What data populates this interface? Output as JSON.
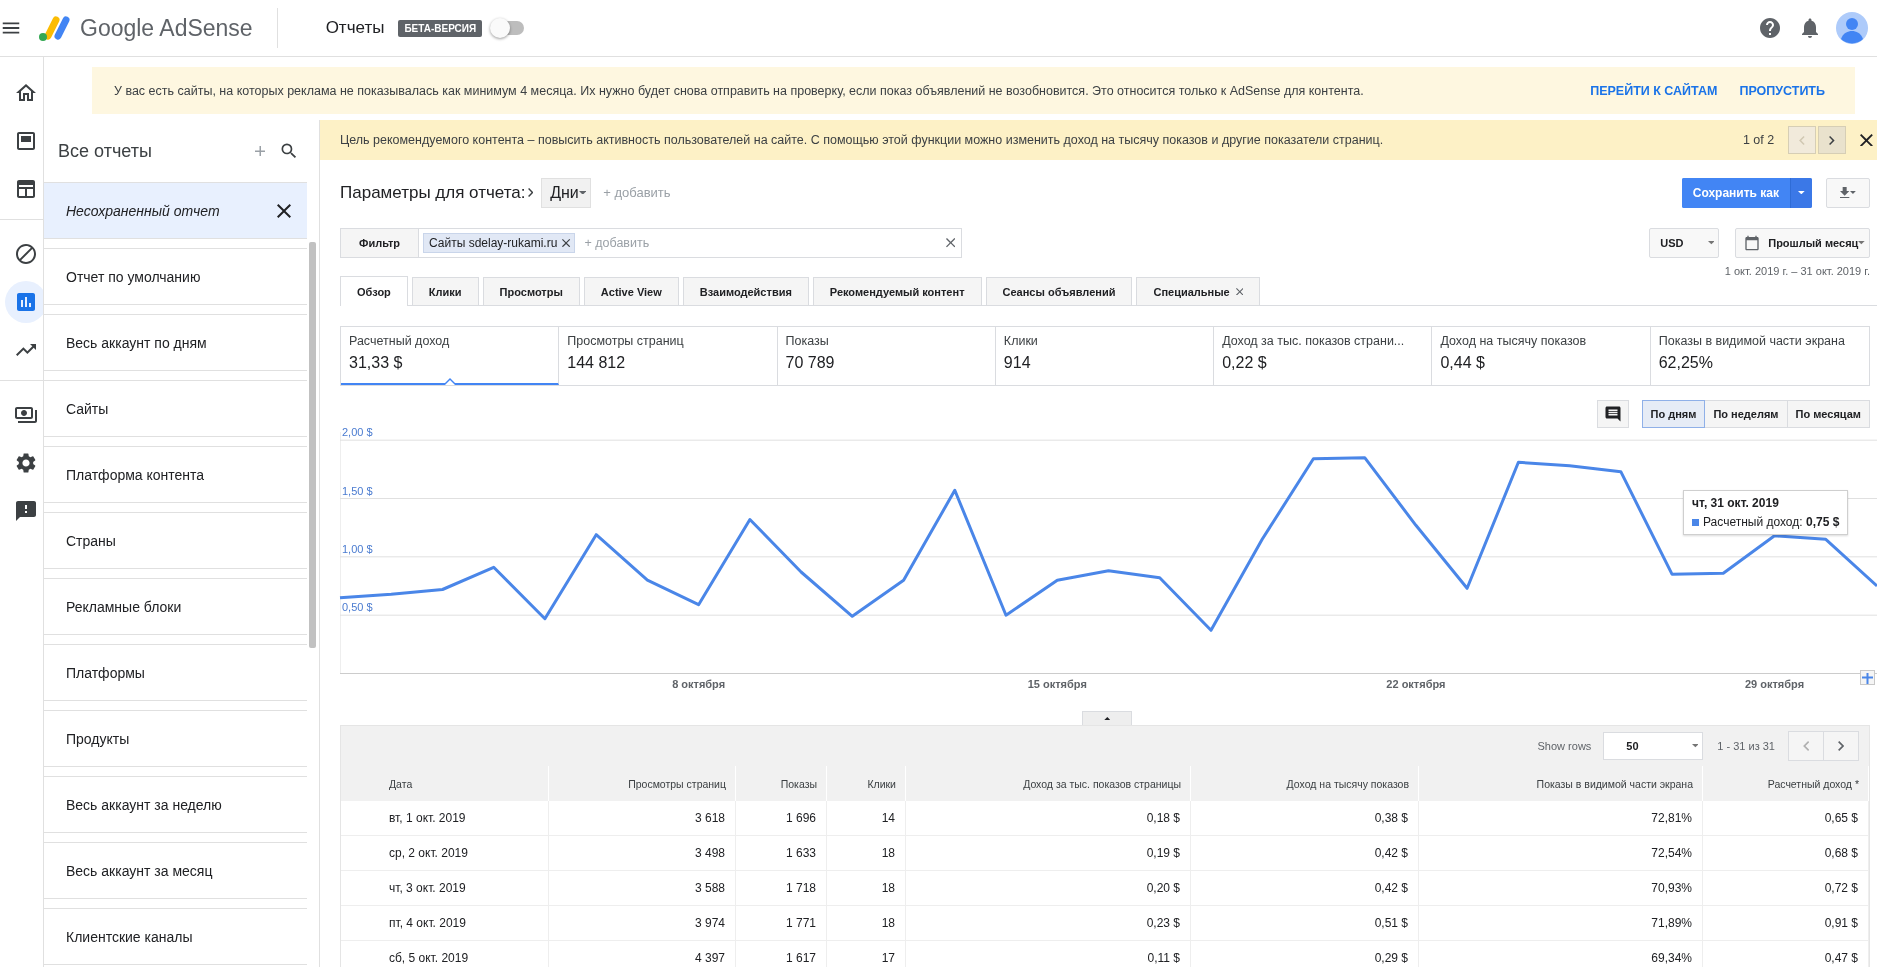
{
  "app_bar": {
    "product": "Google AdSense",
    "section": "Отчеты",
    "badge": "БЕТА-ВЕРСИЯ",
    "beta_toggle": {
      "on": false
    }
  },
  "rail_groups": [
    {
      "items": [
        {
          "kind": "home",
          "selected": false
        },
        {
          "kind": "display",
          "selected": false
        },
        {
          "kind": "layout",
          "selected": false
        }
      ]
    },
    {
      "items": [
        {
          "kind": "block",
          "selected": false
        },
        {
          "kind": "reports",
          "selected": true
        },
        {
          "kind": "trending",
          "selected": false
        }
      ]
    },
    {
      "items": [
        {
          "kind": "payments",
          "selected": false
        },
        {
          "kind": "settings",
          "selected": false
        },
        {
          "kind": "feedback",
          "selected": false
        }
      ]
    }
  ],
  "notice": {
    "text": "У вас есть сайты, на которых реклама не показывалась как минимум 4 месяца. Их нужно будет снова отправить на проверку, если показ объявлений не возобновится. Это относится только к AdSense для контента.",
    "actions": [
      "ПЕРЕЙТИ К САЙТАМ",
      "ПРОПУСТИТЬ"
    ]
  },
  "reports_panel": {
    "title": "Все отчеты",
    "items": [
      {
        "kind": "unsaved",
        "label": "Несохраненный отчет",
        "selected": true
      },
      {
        "kind": "saved",
        "label": "Отчет по умолчанию",
        "selected": false
      },
      {
        "kind": "saved",
        "label": "Весь аккаунт по дням",
        "selected": false
      },
      {
        "kind": "saved",
        "label": "Сайты",
        "selected": false
      },
      {
        "kind": "saved",
        "label": "Платформа контента",
        "selected": false
      },
      {
        "kind": "saved",
        "label": "Страны",
        "selected": false
      },
      {
        "kind": "saved",
        "label": "Рекламные блоки",
        "selected": false
      },
      {
        "kind": "saved",
        "label": "Платформы",
        "selected": false
      },
      {
        "kind": "saved",
        "label": "Продукты",
        "selected": false
      },
      {
        "kind": "saved",
        "label": "Весь аккаунт за неделю",
        "selected": false
      },
      {
        "kind": "saved",
        "label": "Весь аккаунт за месяц",
        "selected": false
      },
      {
        "kind": "saved",
        "label": "Клиентские каналы",
        "selected": false
      }
    ]
  },
  "tip_bar": {
    "text": "Цель рекомендуемого контента – повысить активность пользователей на сайте. С помощью этой функции можно изменить доход на тысячу показов и другие показатели страниц.",
    "pager": "1 of 2",
    "prev_disabled": true
  },
  "report": {
    "params_label": "Параметры для отчета:",
    "dimension": "Дни",
    "add_dimension": "+ добавить",
    "save_button": "Сохранить как",
    "filter_button": "Фильтр",
    "filter_chips": [
      "Сайты sdelay-rukami.ru"
    ],
    "filter_placeholder": "+ добавить",
    "currency": "USD",
    "date_preset": "Прошлый месяц",
    "date_range": "1 окт. 2019 г. – 31 окт. 2019 г.",
    "tabs": [
      {
        "label": "Обзор",
        "selected": true,
        "closable": false
      },
      {
        "label": "Клики",
        "selected": false,
        "closable": false
      },
      {
        "label": "Просмотры",
        "selected": false,
        "closable": false
      },
      {
        "label": "Active View",
        "selected": false,
        "closable": false
      },
      {
        "label": "Взаимодействия",
        "selected": false,
        "closable": false
      },
      {
        "label": "Рекомендуемый контент",
        "selected": false,
        "closable": false
      },
      {
        "label": "Сеансы объявлений",
        "selected": false,
        "closable": false
      },
      {
        "label": "Специальные",
        "selected": false,
        "closable": true
      }
    ]
  },
  "metrics": [
    {
      "label": "Расчетный доход",
      "value": "31,33 $",
      "selected": true
    },
    {
      "label": "Просмотры страниц",
      "value": "144 812",
      "selected": false
    },
    {
      "label": "Показы",
      "value": "70 789",
      "selected": false
    },
    {
      "label": "Клики",
      "value": "914",
      "selected": false
    },
    {
      "label": "Доход за тыс. показов страни...",
      "value": "0,22 $",
      "selected": false
    },
    {
      "label": "Доход на тысячу показов",
      "value": "0,44 $",
      "selected": false
    },
    {
      "label": "Показы в видимой части экрана",
      "value": "62,25%",
      "selected": false
    }
  ],
  "granularity": [
    {
      "label": "По дням",
      "selected": true
    },
    {
      "label": "По неделям",
      "selected": false
    },
    {
      "label": "По месяцам",
      "selected": false
    }
  ],
  "chart": {
    "chart_data": {
      "type": "line",
      "x": [
        1,
        2,
        3,
        4,
        5,
        6,
        7,
        8,
        9,
        10,
        11,
        12,
        13,
        14,
        15,
        16,
        17,
        18,
        19,
        20,
        21,
        22,
        23,
        24,
        25,
        26,
        27,
        28,
        29,
        30,
        31
      ],
      "xlim": [
        1,
        31
      ],
      "ylim": [
        0,
        2.07
      ],
      "grid": true,
      "series": [
        {
          "name": "Расчетный доход",
          "color": "#4a86e8",
          "values": [
            0.65,
            0.68,
            0.72,
            0.91,
            0.47,
            1.19,
            0.8,
            0.59,
            1.32,
            0.87,
            0.49,
            0.8,
            1.57,
            0.5,
            0.8,
            0.88,
            0.82,
            0.37,
            1.15,
            1.84,
            1.85,
            1.27,
            0.73,
            1.81,
            1.78,
            1.73,
            0.85,
            0.86,
            1.18,
            1.15,
            0.75
          ]
        }
      ],
      "yticks": [
        {
          "value": 0.5,
          "label": "0,50 $"
        },
        {
          "value": 1,
          "label": "1,00 $"
        },
        {
          "value": 1.5,
          "label": "1,50 $"
        },
        {
          "value": 2,
          "label": "2,00 $"
        }
      ],
      "xticks": [
        {
          "value": 8,
          "label": "8 октября"
        },
        {
          "value": 15,
          "label": "15 октября"
        },
        {
          "value": 22,
          "label": "22 октября"
        },
        {
          "value": 29,
          "label": "29 октября"
        }
      ]
    },
    "tooltip": {
      "title": "чт, 31 окт. 2019",
      "text": ": **0,75 $**"
    }
  },
  "table": {
    "show_rows_label": "Show rows",
    "rows_per_page": "50",
    "range": "1 - 31 из 31",
    "prev_disabled": true,
    "columns": [
      "Дата",
      "Просмотры страниц",
      "Показы",
      "Клики",
      "Доход за тыс. показов страницы",
      "Доход на тысячу показов",
      "Показы в видимой части экрана",
      "Расчетный доход *"
    ],
    "rows": [
      [
        "вт, 1 окт. 2019",
        "3 618",
        "1 696",
        "14",
        "0,18 $",
        "0,38 $",
        "72,81%",
        "0,65 $"
      ],
      [
        "ср, 2 окт. 2019",
        "3 498",
        "1 633",
        "18",
        "0,19 $",
        "0,42 $",
        "72,54%",
        "0,68 $"
      ],
      [
        "чт, 3 окт. 2019",
        "3 588",
        "1 718",
        "18",
        "0,20 $",
        "0,42 $",
        "70,93%",
        "0,72 $"
      ],
      [
        "пт, 4 окт. 2019",
        "3 974",
        "1 771",
        "18",
        "0,23 $",
        "0,51 $",
        "71,89%",
        "0,91 $"
      ],
      [
        "сб, 5 окт. 2019",
        "4 397",
        "1 617",
        "17",
        "0,11 $",
        "0,29 $",
        "69,34%",
        "0,47 $"
      ]
    ]
  }
}
